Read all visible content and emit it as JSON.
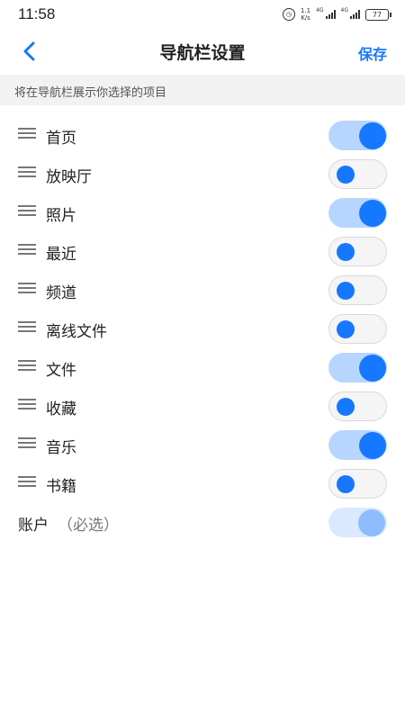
{
  "status_bar": {
    "time": "11:58",
    "speed_value": "1.1",
    "speed_unit": "K/s",
    "network1": "4G",
    "network2": "4G",
    "battery": "77"
  },
  "header": {
    "title": "导航栏设置",
    "save_label": "保存",
    "back_icon": "chevron-left-icon"
  },
  "hint": "将在导航栏展示你选择的项目",
  "items": [
    {
      "label": "首页",
      "on": true
    },
    {
      "label": "放映厅",
      "on": false
    },
    {
      "label": "照片",
      "on": true
    },
    {
      "label": "最近",
      "on": false
    },
    {
      "label": "频道",
      "on": false
    },
    {
      "label": "离线文件",
      "on": false
    },
    {
      "label": "文件",
      "on": true
    },
    {
      "label": "收藏",
      "on": false
    },
    {
      "label": "音乐",
      "on": true
    },
    {
      "label": "书籍",
      "on": false
    }
  ],
  "account": {
    "label": "账户",
    "required": "（必选）",
    "on": true,
    "disabled": true
  },
  "colors": {
    "accent": "#1677ff",
    "toggle_on_track": "#b7d6ff",
    "toggle_off_track": "#f5f5f5",
    "hint_bg": "#f2f2f2"
  }
}
